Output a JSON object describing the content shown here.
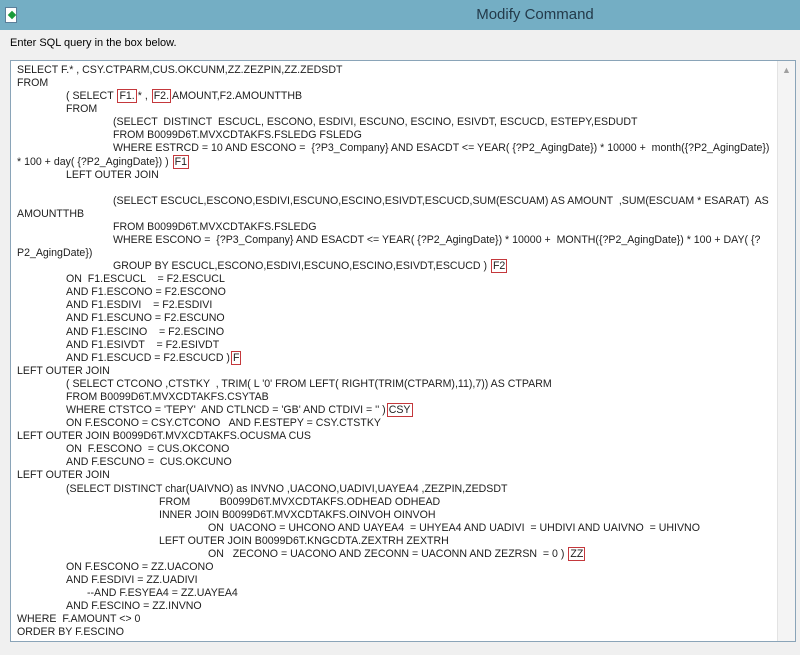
{
  "window": {
    "title": "Modify Command",
    "icon": "app-edit-icon"
  },
  "hint": "Enter SQL query in the box below.",
  "colors": {
    "titlebar": "#74aec4",
    "highlight_box": "#c4383c"
  },
  "sql_lines": [
    [
      {
        "t": "SELECT F.* , CSY.CTPARM,CUS.OKCUNM,ZZ.ZEZPIN,ZZ.ZEDSDT"
      }
    ],
    [
      {
        "t": "FROM"
      }
    ],
    [
      {
        "t": "( SELECT "
      },
      {
        "t": "F1.",
        "boxed": true
      },
      {
        "t": "* , "
      },
      {
        "t": "F2.",
        "boxed": true
      },
      {
        "t": "AMOUNT,F2.AMOUNTTHB"
      }
    ],
    [
      {
        "t": "FROM"
      }
    ],
    [
      {
        "t": "(SELECT  DISTINCT  ESCUCL, ESCONO, ESDIVI, ESCUNO, ESCINO, ESIVDT, ESCUCD, ESTEPY,ESDUDT"
      }
    ],
    [
      {
        "t": "FROM B0099D6T.MVXCDTAKFS.FSLEDG FSLEDG"
      }
    ],
    [
      {
        "t": "WHERE ESTRCD = 10 AND ESCONO =  {?P3_Company} AND ESACDT <= YEAR( {?P2_AgingDate}) * 10000 +  month({?P2_AgingDate})"
      }
    ],
    [
      {
        "t": "* 100 + day( {?P2_AgingDate}) ) "
      },
      {
        "t": "F1",
        "boxed": true
      }
    ],
    [
      {
        "t": "LEFT OUTER JOIN"
      }
    ],
    [
      {
        "t": ""
      }
    ],
    [
      {
        "t": "(SELECT ESCUCL,ESCONO,ESDIVI,ESCUNO,ESCINO,ESIVDT,ESCUCD,SUM(ESCUAM) AS AMOUNT  ,SUM(ESCUAM * ESARAT)  AS"
      }
    ],
    [
      {
        "t": "AMOUNTTHB"
      }
    ],
    [
      {
        "t": "FROM B0099D6T.MVXCDTAKFS.FSLEDG"
      }
    ],
    [
      {
        "t": "WHERE ESCONO =  {?P3_Company} AND ESACDT <= YEAR( {?P2_AgingDate}) * 10000 +  MONTH({?P2_AgingDate}) * 100 + DAY( {?"
      }
    ],
    [
      {
        "t": "P2_AgingDate})"
      }
    ],
    [
      {
        "t": "GROUP BY ESCUCL,ESCONO,ESDIVI,ESCUNO,ESCINO,ESIVDT,ESCUCD ) "
      },
      {
        "t": "F2",
        "boxed": true
      }
    ],
    [
      {
        "t": "ON  F1.ESCUCL    = F2.ESCUCL"
      }
    ],
    [
      {
        "t": "AND F1.ESCONO = F2.ESCONO"
      }
    ],
    [
      {
        "t": "AND F1.ESDIVI    = F2.ESDIVI"
      }
    ],
    [
      {
        "t": "AND F1.ESCUNO = F2.ESCUNO"
      }
    ],
    [
      {
        "t": "AND F1.ESCINO    = F2.ESCINO"
      }
    ],
    [
      {
        "t": "AND F1.ESIVDT    = F2.ESIVDT"
      }
    ],
    [
      {
        "t": "AND F1.ESCUCD = F2.ESCUCD )"
      },
      {
        "t": "F",
        "boxed": true
      }
    ],
    [
      {
        "t": "LEFT OUTER JOIN"
      }
    ],
    [
      {
        "t": "( SELECT CTCONO ,CTSTKY  , TRIM( L '0' FROM LEFT( RIGHT(TRIM(CTPARM),11),7)) AS CTPARM"
      }
    ],
    [
      {
        "t": "FROM B0099D6T.MVXCDTAKFS.CSYTAB"
      }
    ],
    [
      {
        "t": "WHERE CTSTCO = 'TEPY'  AND CTLNCD = 'GB' AND CTDIVI = '' )"
      },
      {
        "t": "CSY",
        "boxed": true
      }
    ],
    [
      {
        "t": "ON F.ESCONO = CSY.CTCONO   AND F.ESTEPY = CSY.CTSTKY"
      }
    ],
    [
      {
        "t": "LEFT OUTER JOIN B0099D6T.MVXCDTAKFS.OCUSMA CUS"
      }
    ],
    [
      {
        "t": "ON  F.ESCONO  = CUS.OKCONO"
      }
    ],
    [
      {
        "t": "AND F.ESCUNO =  CUS.OKCUNO"
      }
    ],
    [
      {
        "t": "LEFT OUTER JOIN"
      }
    ],
    [
      {
        "t": "(SELECT DISTINCT char(UAIVNO) as INVNO ,UACONO,UADIVI,UAYEA4 ,ZEZPIN,ZEDSDT"
      }
    ],
    [
      {
        "t": "FROM          B0099D6T.MVXCDTAKFS.ODHEAD ODHEAD"
      }
    ],
    [
      {
        "t": "INNER JOIN B0099D6T.MVXCDTAKFS.OINVOH OINVOH"
      }
    ],
    [
      {
        "t": "ON  UACONO = UHCONO AND UAYEA4  = UHYEA4 AND UADIVI  = UHDIVI AND UAIVNO  = UHIVNO"
      }
    ],
    [
      {
        "t": "LEFT OUTER JOIN B0099D6T.KNGCDTA.ZEXTRH ZEXTRH"
      }
    ],
    [
      {
        "t": "ON   ZECONO = UACONO AND ZECONN = UACONN AND ZEZRSN  = 0 ) "
      },
      {
        "t": "ZZ",
        "boxed": true
      }
    ],
    [
      {
        "t": "ON F.ESCONO = ZZ.UACONO"
      }
    ],
    [
      {
        "t": "AND F.ESDIVI = ZZ.UADIVI"
      }
    ],
    [
      {
        "t": "--AND F.ESYEA4 = ZZ.UAYEA4"
      }
    ],
    [
      {
        "t": "AND F.ESCINO = ZZ.INVNO"
      }
    ],
    [
      {
        "t": "WHERE  F.AMOUNT <> 0"
      }
    ],
    [
      {
        "t": "ORDER BY F.ESCINO"
      }
    ]
  ]
}
